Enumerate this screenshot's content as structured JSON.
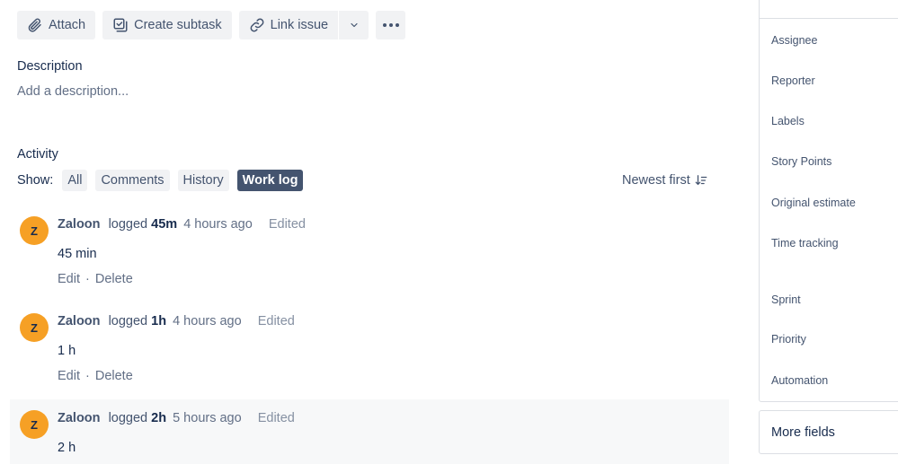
{
  "toolbar": {
    "attach_label": "Attach",
    "create_subtask_label": "Create subtask",
    "link_issue_label": "Link issue"
  },
  "description": {
    "title": "Description",
    "placeholder": "Add a description..."
  },
  "activity": {
    "title": "Activity",
    "show_label": "Show:",
    "filters": [
      "All",
      "Comments",
      "History",
      "Work log"
    ],
    "active_filter": "Work log",
    "sort_label": "Newest first"
  },
  "worklogs": [
    {
      "initial": "Z",
      "author": "Zaloon",
      "verb": "logged",
      "duration": "45m",
      "ago": "4 hours ago",
      "edited": "Edited",
      "body": "45 min",
      "edit_label": "Edit",
      "delete_label": "Delete"
    },
    {
      "initial": "Z",
      "author": "Zaloon",
      "verb": "logged",
      "duration": "1h",
      "ago": "4 hours ago",
      "edited": "Edited",
      "body": "1 h",
      "edit_label": "Edit",
      "delete_label": "Delete"
    },
    {
      "initial": "Z",
      "author": "Zaloon",
      "verb": "logged",
      "duration": "2h",
      "ago": "5 hours ago",
      "edited": "Edited",
      "body": "2 h"
    }
  ],
  "details": {
    "fields": [
      "Assignee",
      "Reporter",
      "Labels",
      "Story Points",
      "Original estimate",
      "Time tracking",
      "Sprint",
      "Priority",
      "Automation"
    ],
    "more_fields_label": "More fields"
  },
  "colors": {
    "avatar": "#f6a025",
    "active_chip": "#44546f",
    "button_bg": "#f1f2f4"
  }
}
